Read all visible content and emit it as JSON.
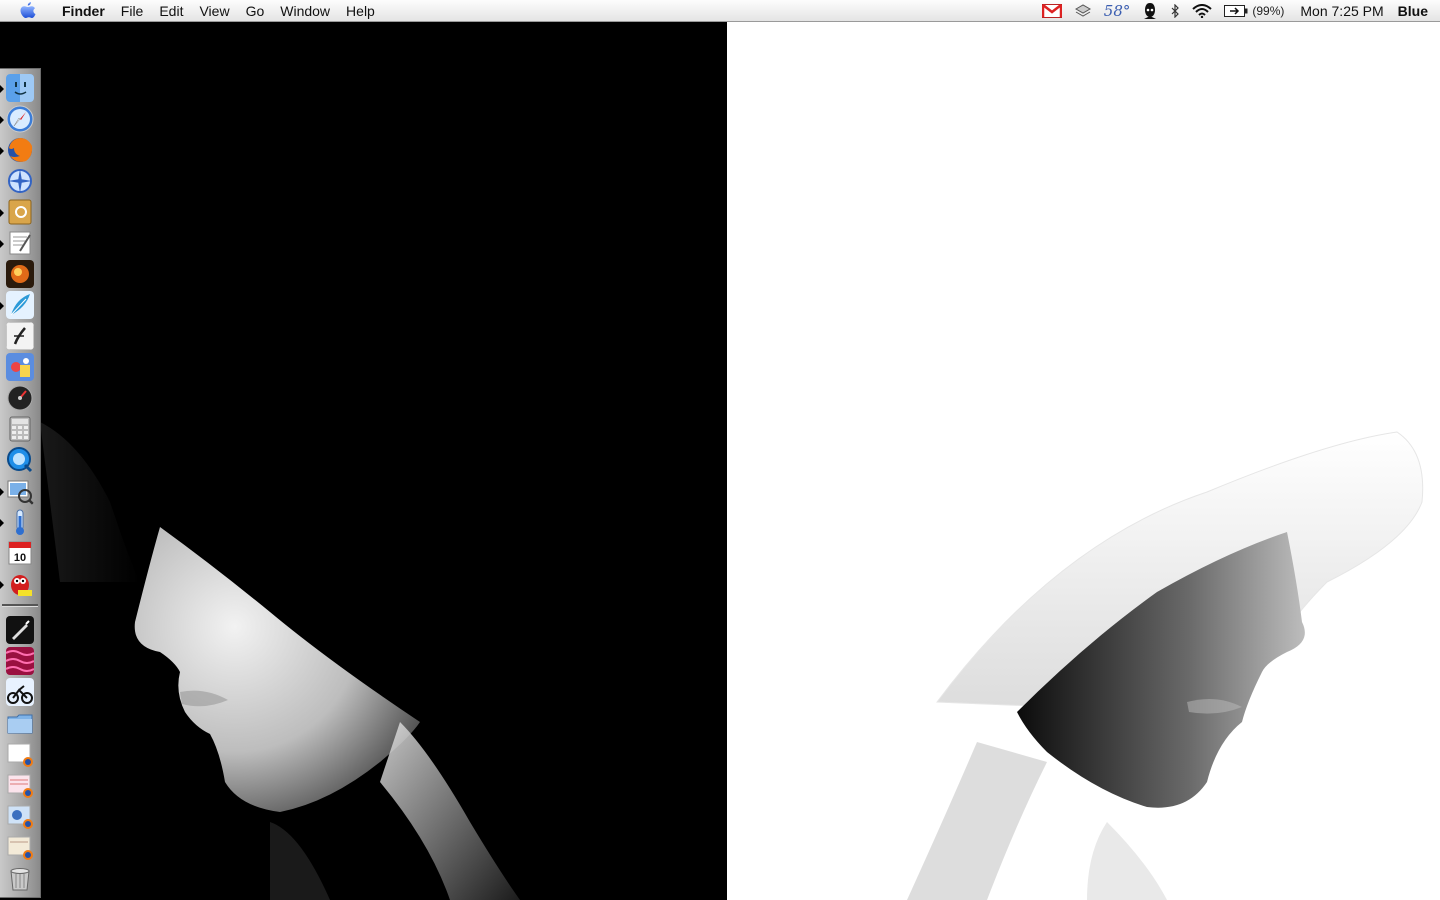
{
  "menubar": {
    "app_name": "Finder",
    "menus": [
      "File",
      "Edit",
      "View",
      "Go",
      "Window",
      "Help"
    ],
    "weather": "58°",
    "battery": "(99%)",
    "clock": "Mon 7:25 PM",
    "user": "Blue",
    "extras_icons": [
      "gmail-icon",
      "sync-icon",
      "weather-icon",
      "incognito-icon",
      "bluetooth-icon",
      "wifi-icon",
      "battery-icon"
    ]
  },
  "dock": {
    "items": [
      {
        "name": "finder",
        "icon": "finder-icon",
        "running": true
      },
      {
        "name": "safari",
        "icon": "safari-icon",
        "running": true
      },
      {
        "name": "firefox",
        "icon": "firefox-icon",
        "running": true
      },
      {
        "name": "camino",
        "icon": "camino-icon",
        "running": false
      },
      {
        "name": "address-book",
        "icon": "address-book-icon",
        "running": true
      },
      {
        "name": "textedit",
        "icon": "textedit-icon",
        "running": true
      },
      {
        "name": "photo-app",
        "icon": "photo-app-icon",
        "running": false
      },
      {
        "name": "feather-app",
        "icon": "feather-icon",
        "running": true
      },
      {
        "name": "script-editor",
        "icon": "script-icon",
        "running": false
      },
      {
        "name": "game",
        "icon": "game-icon",
        "running": false
      },
      {
        "name": "speedometer",
        "icon": "speedometer-icon",
        "running": false
      },
      {
        "name": "calculator",
        "icon": "calculator-icon",
        "running": false
      },
      {
        "name": "quicktime",
        "icon": "quicktime-icon",
        "running": false
      },
      {
        "name": "preview",
        "icon": "preview-icon",
        "running": true
      },
      {
        "name": "thermometer",
        "icon": "thermometer-icon",
        "running": true
      },
      {
        "name": "ical",
        "icon": "ical-icon",
        "running": false
      },
      {
        "name": "adium",
        "icon": "adium-icon",
        "running": true
      }
    ],
    "calendar_day": "10",
    "stack_items": [
      {
        "name": "pen-doc",
        "icon": "pen-icon"
      },
      {
        "name": "pattern",
        "icon": "pattern-icon"
      },
      {
        "name": "motorbike",
        "icon": "motorbike-icon"
      },
      {
        "name": "documents-folder",
        "icon": "folder-icon"
      },
      {
        "name": "firefox-doc-1",
        "icon": "firefox-doc-icon"
      },
      {
        "name": "firefox-doc-2",
        "icon": "firefox-doc-icon"
      },
      {
        "name": "firefox-doc-3",
        "icon": "firefox-doc-icon"
      },
      {
        "name": "firefox-doc-4",
        "icon": "firefox-doc-icon"
      },
      {
        "name": "trash",
        "icon": "trash-icon"
      }
    ]
  },
  "colors": {
    "menubar_top": "#fdfdfd",
    "menubar_bottom": "#e4e4e4",
    "wallpaper_dark": "#000000",
    "wallpaper_light": "#ffffff"
  }
}
